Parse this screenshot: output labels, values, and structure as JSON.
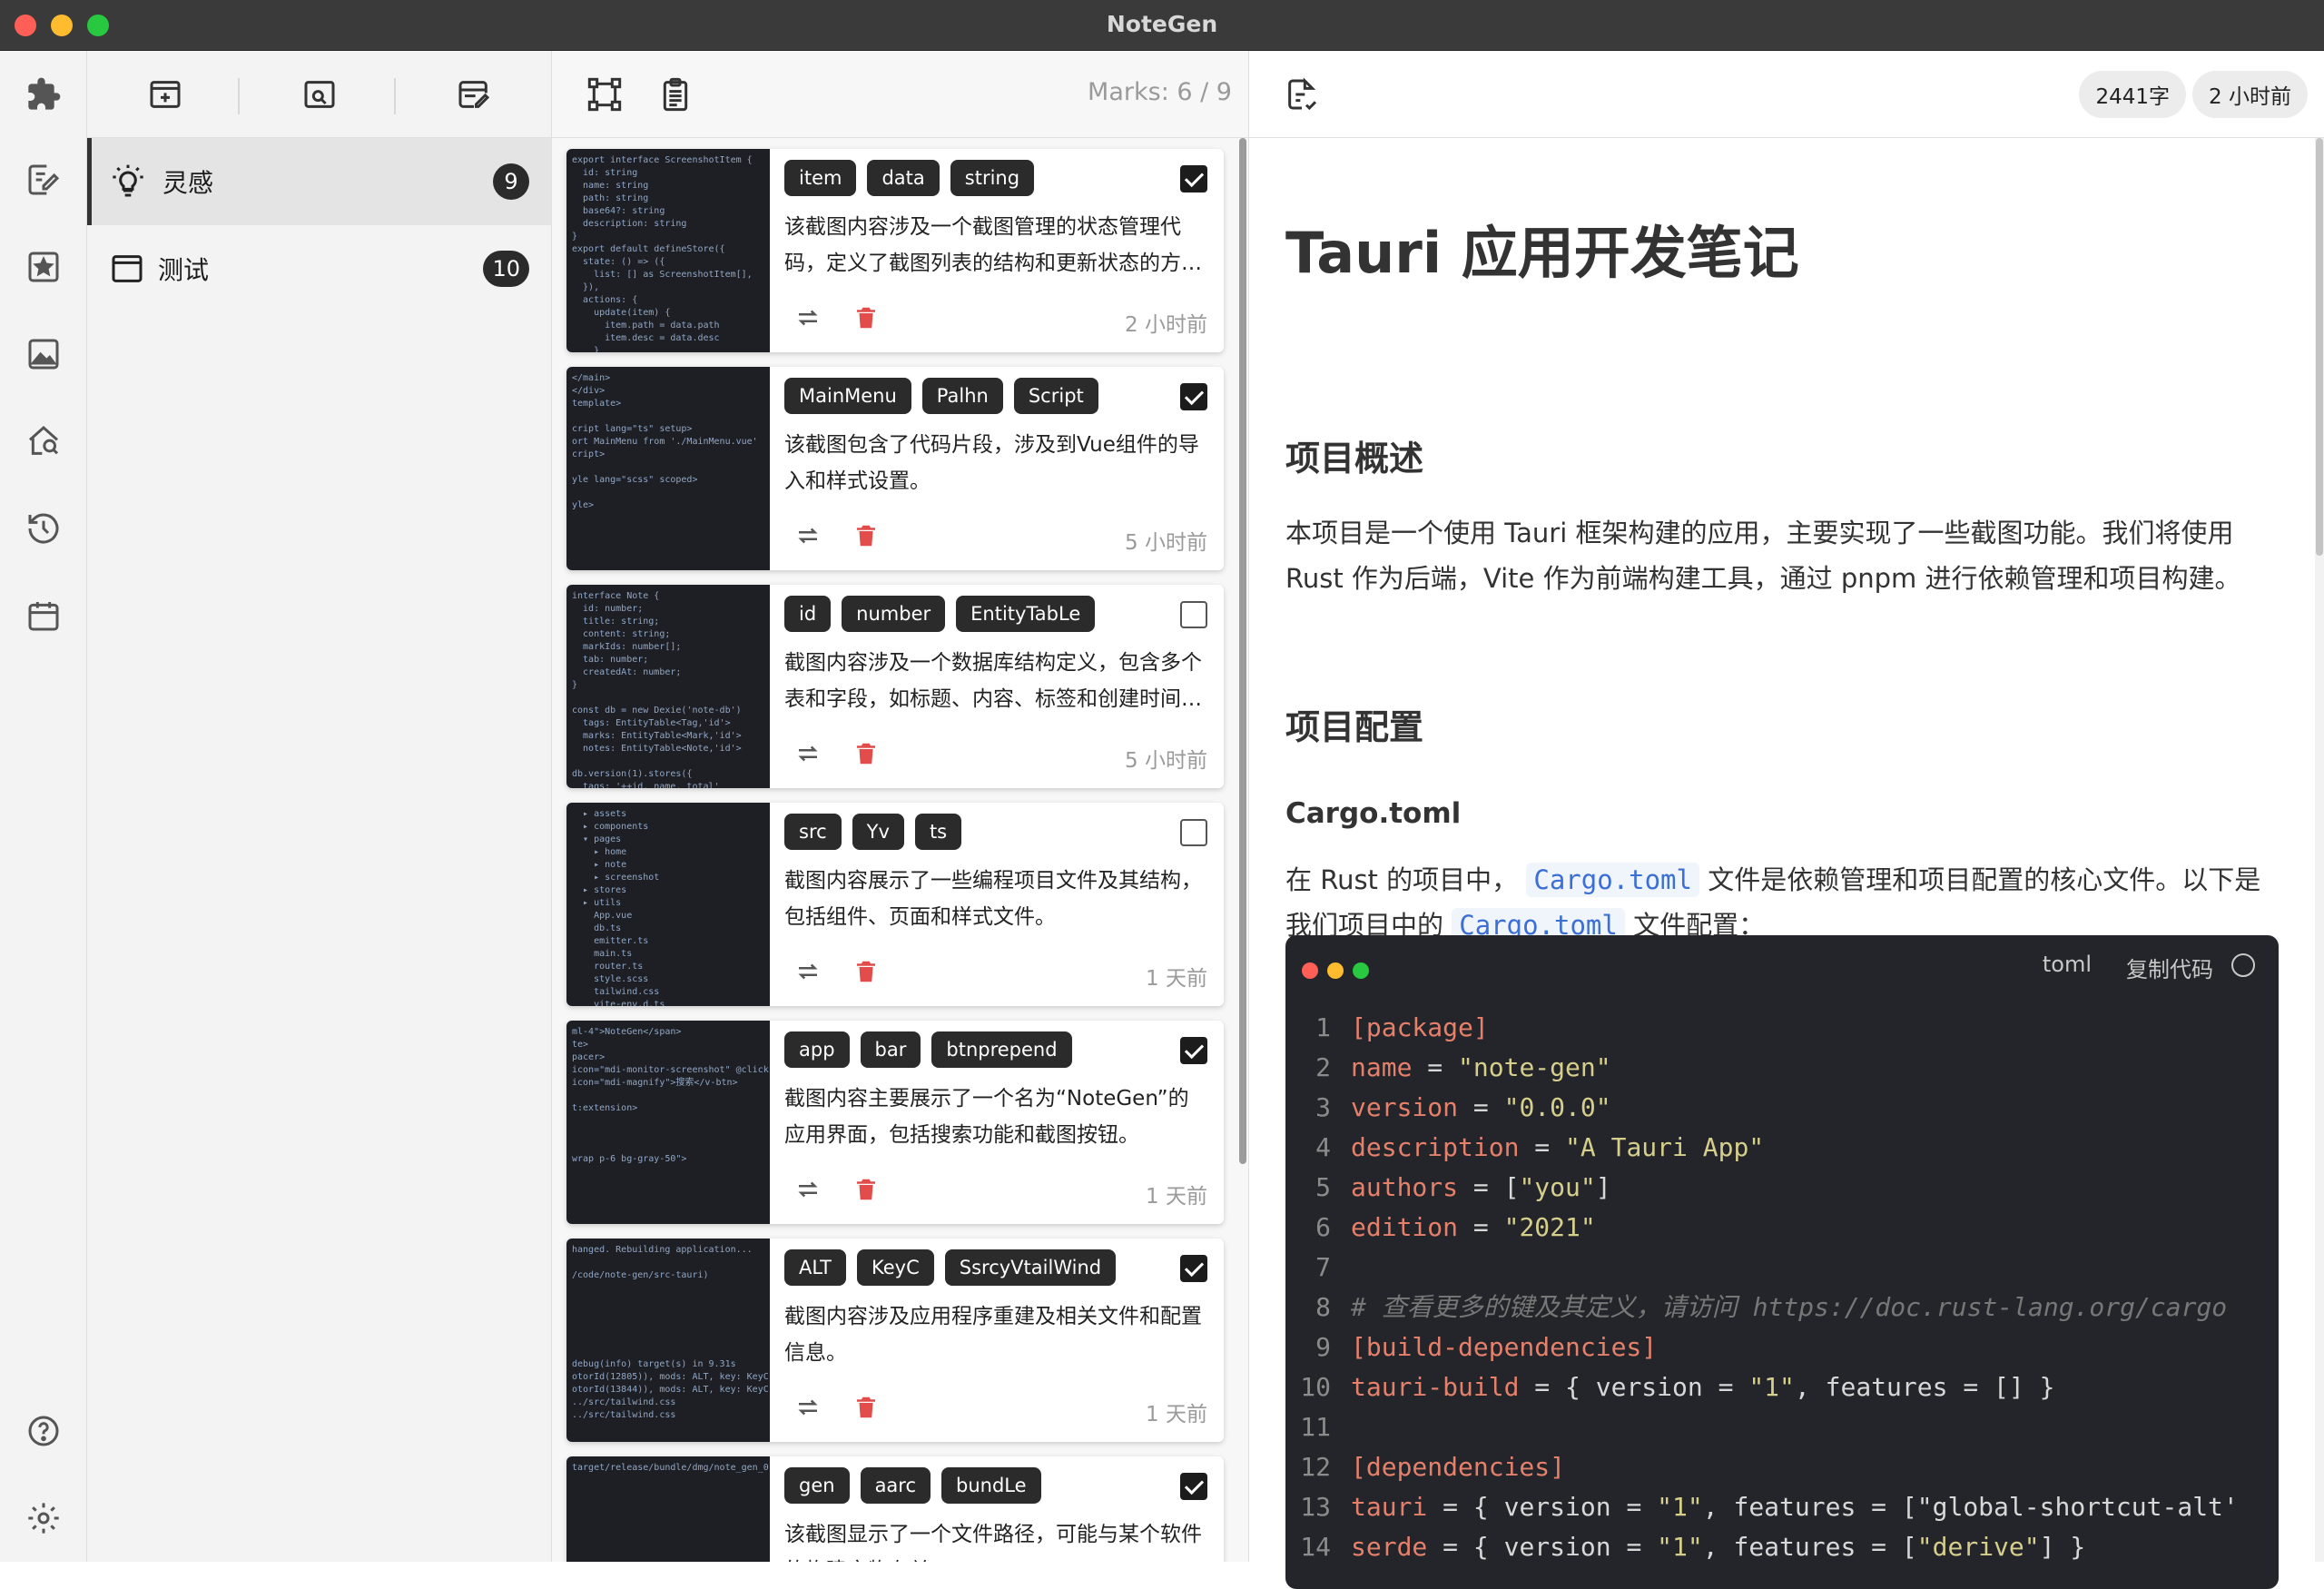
{
  "window": {
    "title": "NoteGen"
  },
  "rail": {
    "icons": [
      "puzzle-icon",
      "edit-note-icon",
      "star-icon",
      "image-icon",
      "home-search-icon",
      "history-icon",
      "calendar-icon",
      "help-icon",
      "settings-icon"
    ]
  },
  "tags": [
    {
      "label": "灵感",
      "count": "9",
      "icon": "lightbulb-icon",
      "active": true
    },
    {
      "label": "测试",
      "count": "10",
      "icon": "folder-icon",
      "active": false
    }
  ],
  "marks": {
    "counter": "Marks: 6 / 9",
    "items": [
      {
        "tags": [
          "item",
          "data",
          "string"
        ],
        "checked": true,
        "desc": "该截图内容涉及一个截图管理的状态管理代码，定义了截图列表的结构和更新状态的方法。",
        "time": "2 小时前"
      },
      {
        "tags": [
          "MainMenu",
          "Palhn",
          "Script"
        ],
        "checked": true,
        "desc": "该截图包含了代码片段，涉及到Vue组件的导入和样式设置。",
        "time": "5 小时前"
      },
      {
        "tags": [
          "id",
          "number",
          "EntityTabLe"
        ],
        "checked": false,
        "desc": "截图内容涉及一个数据库结构定义，包含多个表和字段，如标题、内容、标签和创建时间等。",
        "time": "5 小时前"
      },
      {
        "tags": [
          "src",
          "Yv",
          "ts"
        ],
        "checked": false,
        "desc": "截图内容展示了一些编程项目文件及其结构，包括组件、页面和样式文件。",
        "time": "1 天前"
      },
      {
        "tags": [
          "app",
          "bar",
          "btnprepend"
        ],
        "checked": true,
        "desc": "截图内容主要展示了一个名为“NoteGen”的应用界面，包括搜索功能和截图按钮。",
        "time": "1 天前"
      },
      {
        "tags": [
          "ALT",
          "KeyC",
          "SsrcyVtailWind"
        ],
        "checked": true,
        "desc": "截图内容涉及应用程序重建及相关文件和配置信息。",
        "time": "1 天前"
      },
      {
        "tags": [
          "gen",
          "aarc",
          "bundLe"
        ],
        "checked": true,
        "desc": "该截图显示了一个文件路径，可能与某个软件的构建产物有关。",
        "time": ""
      }
    ]
  },
  "editor": {
    "word_count": "2441字",
    "updated": "2 小时前",
    "title": "Tauri 应用开发笔记",
    "h_overview": "项目概述",
    "p_overview": "本项目是一个使用 Tauri 框架构建的应用，主要实现了一些截图功能。我们将使用 Rust 作为后端，Vite 作为前端构建工具，通过 pnpm 进行依赖管理和项目构建。",
    "h_config": "项目配置",
    "h_cargo": "Cargo.toml",
    "p_cargo_1": "在 Rust 的项目中，",
    "p_cargo_code": "Cargo.toml",
    "p_cargo_2": "文件是依赖管理和项目配置的核心文件。以下是我们项目中的",
    "p_cargo_code2": "Cargo.toml",
    "p_cargo_3": "文件配置：",
    "code": {
      "lang": "toml",
      "copy": "复制代码",
      "lines": [
        {
          "n": "1",
          "t": "[package]"
        },
        {
          "n": "2",
          "t": "name = \"note-gen\""
        },
        {
          "n": "3",
          "t": "version = \"0.0.0\""
        },
        {
          "n": "4",
          "t": "description = \"A Tauri App\""
        },
        {
          "n": "5",
          "t": "authors = [\"you\"]"
        },
        {
          "n": "6",
          "t": "edition = \"2021\""
        },
        {
          "n": "7",
          "t": ""
        },
        {
          "n": "8",
          "t": "# 查看更多的键及其定义，请访问 https://doc.rust-lang.org/cargo"
        },
        {
          "n": "9",
          "t": "[build-dependencies]"
        },
        {
          "n": "10",
          "t": "tauri-build = { version = \"1\", features = [] }"
        },
        {
          "n": "11",
          "t": ""
        },
        {
          "n": "12",
          "t": "[dependencies]"
        },
        {
          "n": "13",
          "t": "tauri = { version = \"1\", features = [\"global-shortcut-alt'"
        },
        {
          "n": "14",
          "t": "serde = { version = \"1\", features = [\"derive\"] }"
        }
      ]
    }
  }
}
